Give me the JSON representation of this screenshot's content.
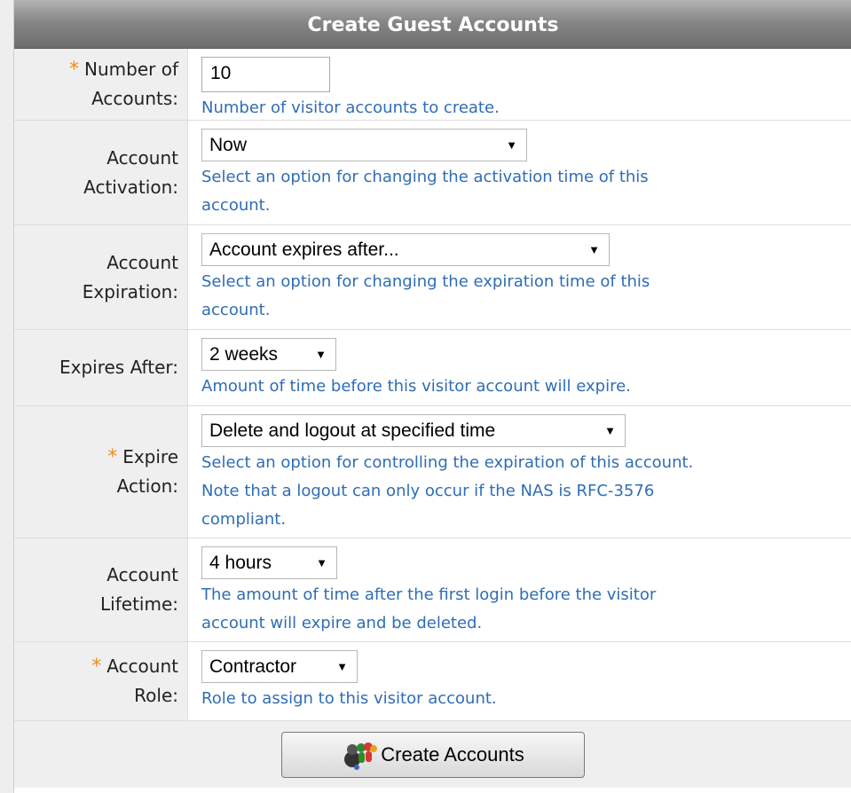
{
  "title": "Create Guest Accounts",
  "fields": [
    {
      "label_line1": "Number of",
      "label_line2": "Accounts:",
      "required": true,
      "value": "10",
      "description": "Number of visitor accounts to create."
    },
    {
      "label_line1": "Account",
      "label_line2": "Activation:",
      "required": false,
      "value": "Now",
      "description_line1": "Select an option for changing the activation time of this",
      "description_line2": "account."
    },
    {
      "label_line1": "Account",
      "label_line2": "Expiration:",
      "required": false,
      "value": "Account expires after...",
      "description_line1": "Select an option for changing the expiration time of this",
      "description_line2": "account."
    },
    {
      "label": "Expires After:",
      "required": false,
      "value": "2 weeks",
      "description": "Amount of time before this visitor account will expire."
    },
    {
      "label_line1": "Expire",
      "label_line2": "Action:",
      "required": true,
      "value": "Delete and logout at specified time",
      "description_line1": "Select an option for controlling the expiration of this account.",
      "description_line2": "Note that a logout can only occur if the NAS is RFC-3576",
      "description_line3": "compliant."
    },
    {
      "label_line1": "Account",
      "label_line2": "Lifetime:",
      "required": false,
      "value": "4 hours",
      "description_line1": "The amount of time after the first login before the visitor",
      "description_line2": "account will expire and be deleted."
    },
    {
      "label_line1": "Account",
      "label_line2": "Role:",
      "required": true,
      "value": "Contractor",
      "description": "Role to assign to this visitor account."
    }
  ],
  "required_marker": "*",
  "submit_label": "Create Accounts",
  "icons": {
    "submit": "group-users-icon",
    "dropdown": "caret-down-icon"
  },
  "colors": {
    "required": "#f28a1b",
    "description": "#2f6db5",
    "title_bar": "#868686"
  }
}
